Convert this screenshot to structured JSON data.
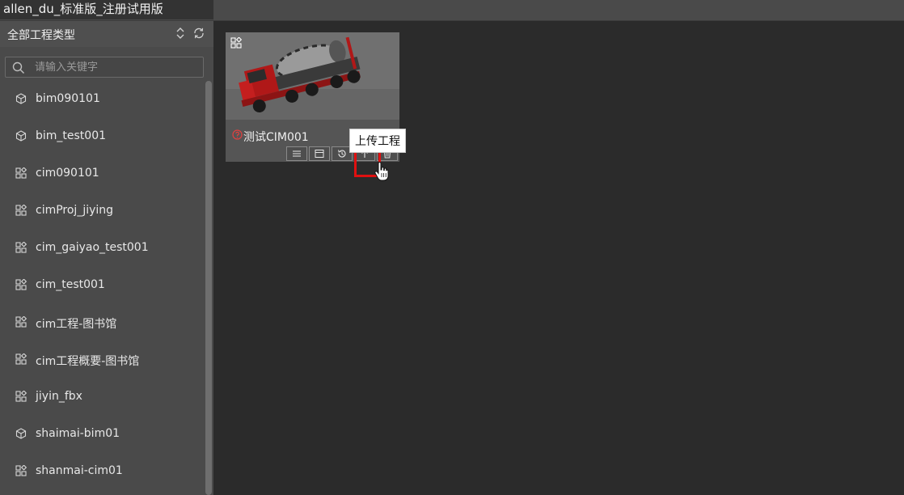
{
  "app": {
    "title": "allen_du_标准版_注册试用版"
  },
  "sidebar": {
    "type_filter": "全部工程类型",
    "search": {
      "placeholder": "请输入关键字",
      "value": ""
    },
    "items": [
      {
        "label": "bim090101",
        "icon": "cube-icon"
      },
      {
        "label": "bim_test001",
        "icon": "cube-icon"
      },
      {
        "label": "cim090101",
        "icon": "grid-icon"
      },
      {
        "label": "cimProj_jiying",
        "icon": "grid-icon"
      },
      {
        "label": "cim_gaiyao_test001",
        "icon": "grid-icon"
      },
      {
        "label": "cim_test001",
        "icon": "grid-icon"
      },
      {
        "label": "cim工程-图书馆",
        "icon": "grid-icon"
      },
      {
        "label": "cim工程概要-图书馆",
        "icon": "grid-icon"
      },
      {
        "label": "jiyin_fbx",
        "icon": "grid-icon"
      },
      {
        "label": "shaimai-bim01",
        "icon": "cube-icon"
      },
      {
        "label": "shanmai-cim01",
        "icon": "grid-icon"
      }
    ]
  },
  "main": {
    "project_card": {
      "name": "测试CIM001",
      "status_icon": "question-circle-icon",
      "type_icon": "grid-icon",
      "status_color": "#e04040",
      "toolbar": [
        "menu-icon",
        "window-icon",
        "history-icon",
        "upload-icon",
        "trash-icon"
      ],
      "tooltip": "上传工程"
    }
  },
  "colors": {
    "highlight": "#e01010"
  }
}
